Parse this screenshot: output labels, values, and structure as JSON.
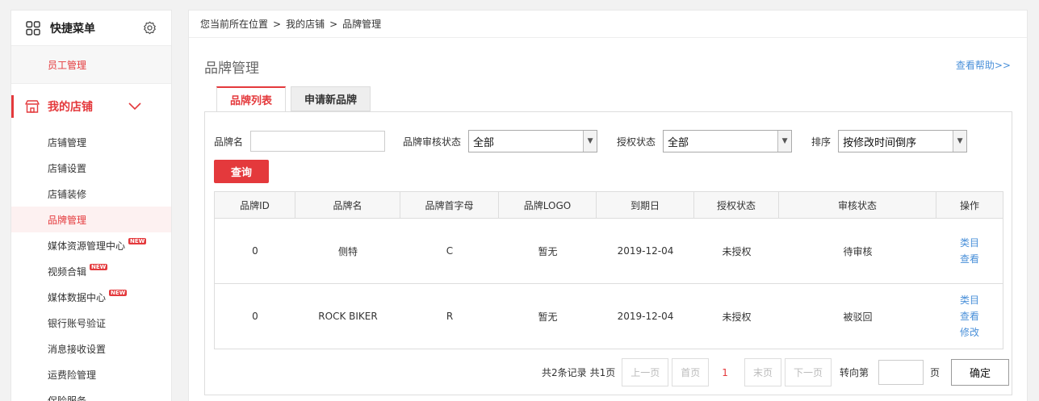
{
  "sidebar": {
    "title": "快捷菜单",
    "quick_item": "员工管理",
    "section_label": "我的店铺",
    "items": [
      {
        "label": "店铺管理",
        "new": false,
        "active": false
      },
      {
        "label": "店铺设置",
        "new": false,
        "active": false
      },
      {
        "label": "店铺装修",
        "new": false,
        "active": false
      },
      {
        "label": "品牌管理",
        "new": false,
        "active": true
      },
      {
        "label": "媒体资源管理中心",
        "new": true,
        "active": false
      },
      {
        "label": "视频合辑",
        "new": true,
        "active": false
      },
      {
        "label": "媒体数据中心",
        "new": true,
        "active": false
      },
      {
        "label": "银行账号验证",
        "new": false,
        "active": false
      },
      {
        "label": "消息接收设置",
        "new": false,
        "active": false
      },
      {
        "label": "运费险管理",
        "new": false,
        "active": false
      },
      {
        "label": "保险服务",
        "new": false,
        "active": false
      }
    ],
    "new_badge": "NEW"
  },
  "breadcrumb": [
    "您当前所在位置",
    ">",
    "我的店铺",
    ">",
    "品牌管理"
  ],
  "page_title": "品牌管理",
  "help_link": "查看帮助>>",
  "tabs": [
    "品牌列表",
    "申请新品牌"
  ],
  "filters": {
    "brand_name_label": "品牌名",
    "brand_name_value": "",
    "review_status_label": "品牌审核状态",
    "review_status_value": "全部",
    "auth_status_label": "授权状态",
    "auth_status_value": "全部",
    "sort_label": "排序",
    "sort_value": "按修改时间倒序",
    "query_button": "查询"
  },
  "table": {
    "columns": [
      "品牌ID",
      "品牌名",
      "品牌首字母",
      "品牌LOGO",
      "到期日",
      "授权状态",
      "审核状态",
      "操作"
    ],
    "rows": [
      {
        "id": "0",
        "name": "侧特",
        "initial": "C",
        "logo": "暂无",
        "expiry": "2019-12-04",
        "auth": "未授权",
        "review": "待审核",
        "ops": [
          "类目",
          "查看"
        ]
      },
      {
        "id": "0",
        "name": "ROCK BIKER",
        "initial": "R",
        "logo": "暂无",
        "expiry": "2019-12-04",
        "auth": "未授权",
        "review": "被驳回",
        "ops": [
          "类目",
          "查看",
          "修改"
        ]
      }
    ]
  },
  "pager": {
    "summary": "共2条记录",
    "pages": "共1页",
    "prev": "上一页",
    "first": "首页",
    "current": "1",
    "last": "末页",
    "next": "下一页",
    "goto_label": "转向第",
    "goto_value": "",
    "page_suffix": "页",
    "confirm": "确定"
  },
  "colors": {
    "accent": "#e4393c",
    "link": "#4a90d9"
  }
}
